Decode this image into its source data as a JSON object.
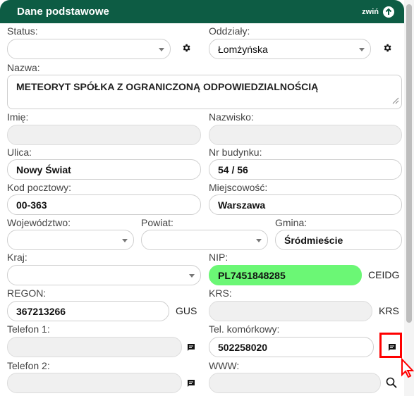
{
  "header": {
    "title": "Dane podstawowe",
    "collapse_label": "zwiń"
  },
  "fields": {
    "status": {
      "label": "Status:",
      "value": ""
    },
    "oddzialy": {
      "label": "Oddziały:",
      "value": "Łomżyńska"
    },
    "nazwa": {
      "label": "Nazwa:",
      "value": "METEORYT SPÓŁKA Z OGRANICZONĄ ODPOWIEDZIALNOŚCIĄ"
    },
    "imie": {
      "label": "Imię:",
      "value": ""
    },
    "nazwisko": {
      "label": "Nazwisko:",
      "value": ""
    },
    "ulica": {
      "label": "Ulica:",
      "value": "Nowy Świat"
    },
    "nr_budynku": {
      "label": "Nr budynku:",
      "value": "54 / 56"
    },
    "kod": {
      "label": "Kod pocztowy:",
      "value": "00-363"
    },
    "miejscowosc": {
      "label": "Miejscowość:",
      "value": "Warszawa"
    },
    "wojewodztwo": {
      "label": "Województwo:",
      "value": ""
    },
    "powiat": {
      "label": "Powiat:",
      "value": ""
    },
    "gmina": {
      "label": "Gmina:",
      "value": "Śródmieście"
    },
    "kraj": {
      "label": "Kraj:",
      "value": ""
    },
    "nip": {
      "label": "NIP:",
      "value": "PL7451848285",
      "button": "CEIDG"
    },
    "regon": {
      "label": "REGON:",
      "value": "367213266",
      "button": "GUS"
    },
    "krs": {
      "label": "KRS:",
      "value": "",
      "button": "KRS"
    },
    "telefon1": {
      "label": "Telefon 1:",
      "value": ""
    },
    "tel_kom": {
      "label": "Tel. komórkowy:",
      "value": "502258020"
    },
    "telefon2": {
      "label": "Telefon 2:",
      "value": ""
    },
    "www": {
      "label": "WWW:",
      "value": ""
    }
  },
  "colors": {
    "header_bg": "#0d5c44",
    "nip_bg": "#6bf775",
    "highlight": "#ff0000"
  },
  "icons": [
    "gear-icon",
    "arrow-up-circle-icon",
    "chevron-down-icon",
    "message-icon",
    "search-icon",
    "resize-grip-icon",
    "cursor-arrow-icon"
  ]
}
